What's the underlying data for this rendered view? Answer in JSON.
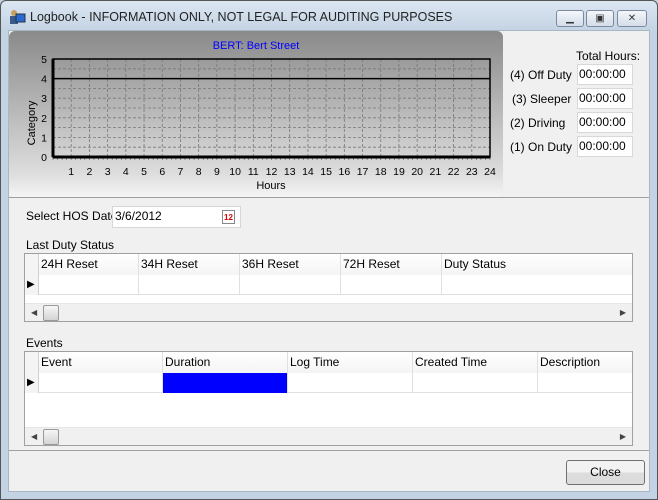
{
  "window": {
    "title": "Logbook - INFORMATION ONLY,  NOT LEGAL FOR AUDITING PURPOSES",
    "minimize_icon": "minimize-icon",
    "maximize_icon": "maximize-icon",
    "close_icon": "close-icon"
  },
  "chart_data": {
    "type": "line",
    "title": "BERT: Bert  Street",
    "xlabel": "Hours",
    "ylabel": "Category",
    "xlim": [
      0,
      24
    ],
    "ylim": [
      0,
      5
    ],
    "x_ticks": [
      "1",
      "2",
      "3",
      "4",
      "5",
      "6",
      "7",
      "8",
      "9",
      "10",
      "11",
      "12",
      "13",
      "14",
      "15",
      "16",
      "17",
      "18",
      "19",
      "20",
      "21",
      "22",
      "23",
      "24"
    ],
    "y_ticks": [
      "0",
      "1",
      "2",
      "3",
      "4",
      "5"
    ],
    "grid": true,
    "series": [
      {
        "x": [
          0,
          24
        ],
        "y": [
          4,
          4
        ]
      }
    ],
    "colors": {
      "title": "#0000ff",
      "line": "#000000"
    }
  },
  "totals": {
    "header": "Total Hours:",
    "rows": [
      {
        "label": "(4) Off Duty",
        "value": "00:00:00"
      },
      {
        "label": "(3)  Sleeper",
        "value": "00:00:00"
      },
      {
        "label": "(2)  Driving",
        "value": "00:00:00"
      },
      {
        "label": "(1)  On Duty",
        "value": "00:00:00"
      }
    ]
  },
  "date": {
    "label": "Select HOS Date",
    "value": "3/6/2012",
    "icon": "calendar-icon"
  },
  "last_duty": {
    "label": "Last Duty Status",
    "columns": [
      "24H Reset",
      "34H Reset",
      "36H Reset",
      "72H Reset",
      "Duty Status"
    ]
  },
  "events": {
    "label": "Events",
    "columns": [
      "Event",
      "Duration",
      "Log Time",
      "Created Time",
      "Description"
    ],
    "selected_color": "#0000ff"
  },
  "close_label": "Close"
}
